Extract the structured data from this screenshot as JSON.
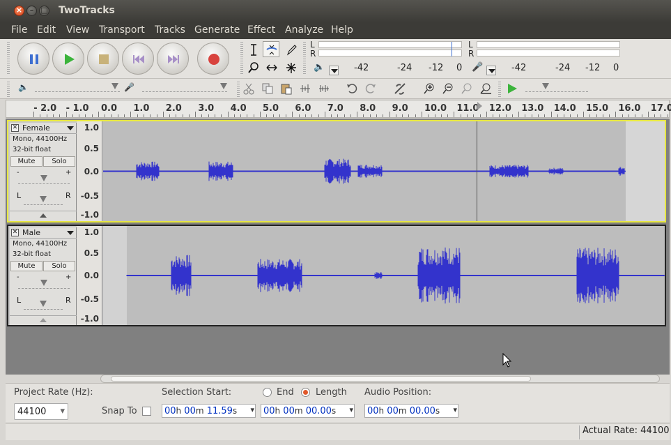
{
  "window": {
    "title": "TwoTracks"
  },
  "menu": [
    "File",
    "Edit",
    "View",
    "Transport",
    "Tracks",
    "Generate",
    "Effect",
    "Analyze",
    "Help"
  ],
  "meters": {
    "play_l": "L",
    "play_r": "R",
    "rec_l": "L",
    "rec_r": "R",
    "play_scale": [
      "-42",
      "-24",
      "-12",
      "0"
    ],
    "rec_scale": [
      "-42",
      "-24",
      "-12",
      "0"
    ]
  },
  "ruler": {
    "labels": [
      "- 2.0",
      "- 1.0",
      "0.0",
      "1.0",
      "2.0",
      "3.0",
      "4.0",
      "5.0",
      "6.0",
      "7.0",
      "8.0",
      "9.0",
      "10.0",
      "11.0",
      "12.0",
      "13.0",
      "14.0",
      "15.0",
      "16.0",
      "17.0"
    ]
  },
  "tracks": [
    {
      "name": "Female",
      "meta1": "Mono, 44100Hz",
      "meta2": "32-bit float",
      "mute": "Mute",
      "solo": "Solo",
      "gain_l": "L",
      "gain_r": "R",
      "scale": [
        "1.0",
        "0.5",
        "0.0",
        "-0.5",
        "-1.0"
      ]
    },
    {
      "name": "Male",
      "meta1": "Mono, 44100Hz",
      "meta2": "32-bit float",
      "mute": "Mute",
      "solo": "Solo",
      "gain_l": "L",
      "gain_r": "R",
      "scale": [
        "1.0",
        "0.5",
        "0.0",
        "-0.5",
        "-1.0"
      ]
    }
  ],
  "selection": {
    "project_rate_label": "Project Rate (Hz):",
    "project_rate": "44100",
    "snap_to": "Snap To",
    "sel_start_label": "Selection Start:",
    "end_label": "End",
    "length_label": "Length",
    "audio_pos_label": "Audio Position:",
    "start_value": {
      "h": "00",
      "m": "00",
      "s": "11.59"
    },
    "length_value": {
      "h": "00",
      "m": "00",
      "s": "00.00"
    },
    "audio_pos_value": {
      "h": "00",
      "m": "00",
      "s": "00.00"
    },
    "unit_h": "h",
    "unit_m": "m",
    "unit_s": "s"
  },
  "status": {
    "actual_rate": "Actual Rate: 44100"
  },
  "colors": {
    "waveform": "#3333cc",
    "selected_track_border": "#e8e840",
    "accent": "#e0582a"
  }
}
